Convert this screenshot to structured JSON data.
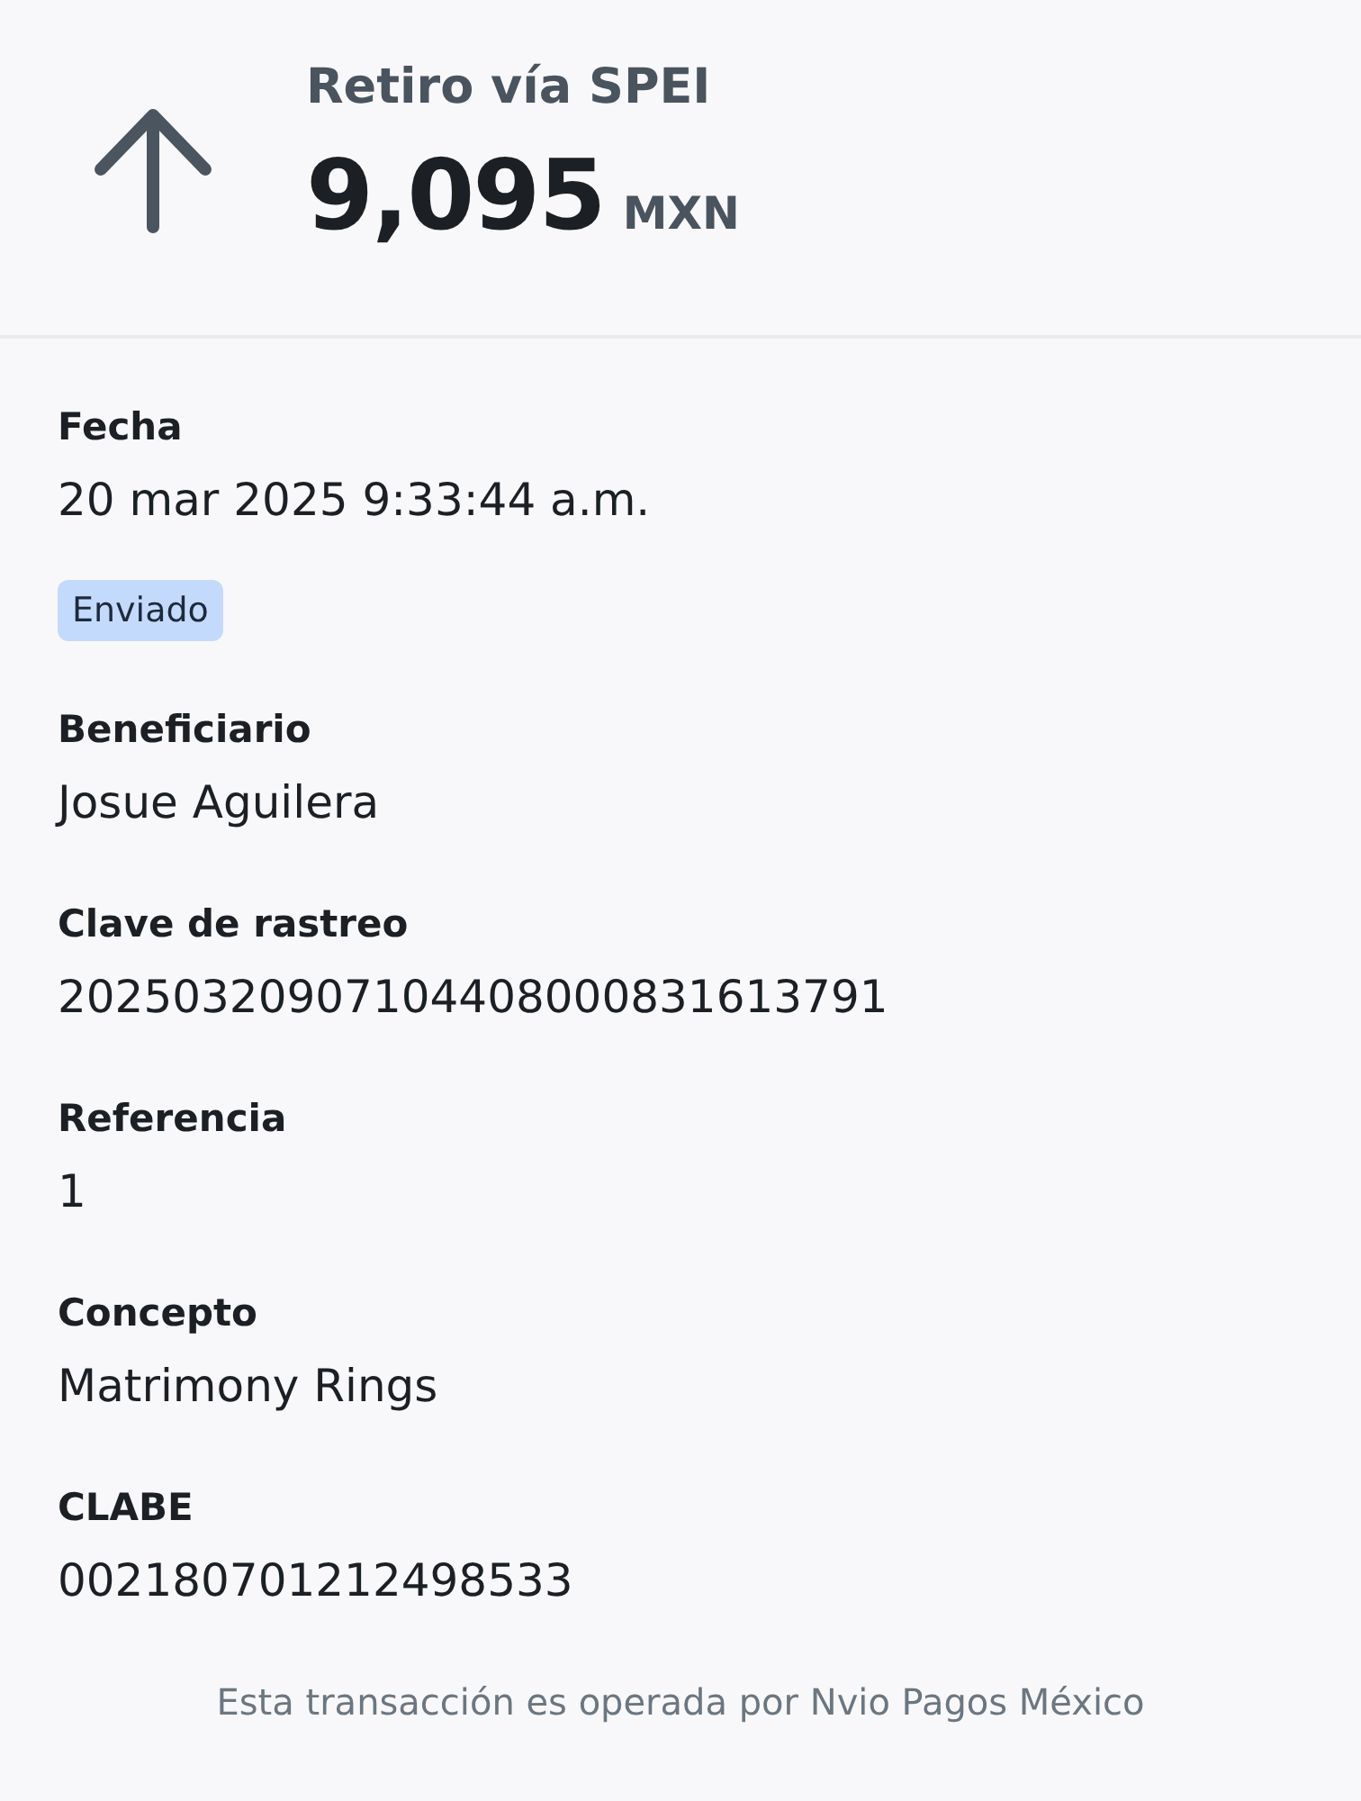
{
  "header": {
    "title": "Retiro vía SPEI",
    "amount": "9,095",
    "currency": "MXN"
  },
  "details": [
    {
      "kind": "field",
      "label": "Fecha",
      "value": "20 mar 2025 9:33:44 a.m."
    },
    {
      "kind": "status",
      "text": "Enviado"
    },
    {
      "kind": "field",
      "label": "Beneficiario",
      "value": "Josue Aguilera"
    },
    {
      "kind": "field",
      "label": "Clave de rastreo",
      "value": "20250320907104408000831613791"
    },
    {
      "kind": "field",
      "label": "Referencia",
      "value": "1"
    },
    {
      "kind": "field",
      "label": "Concepto",
      "value": "Matrimony Rings"
    },
    {
      "kind": "field",
      "label": "CLABE",
      "value": "002180701212498533"
    }
  ],
  "footer": "Esta transacción es operada por Nvio Pagos México"
}
